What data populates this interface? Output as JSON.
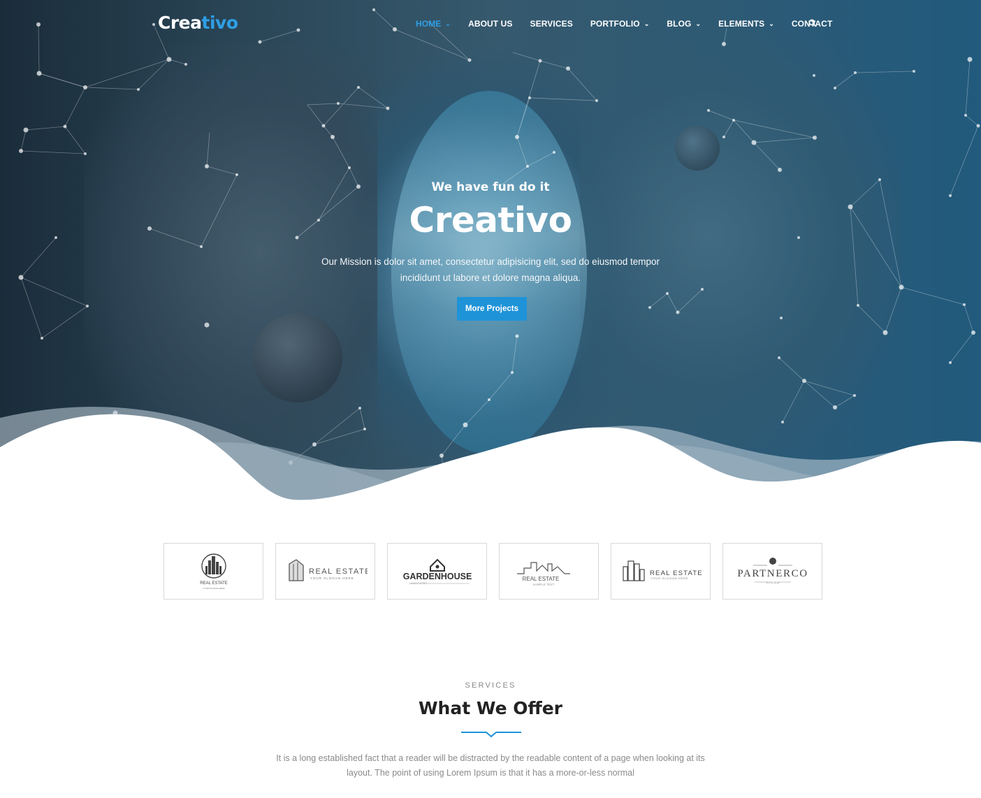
{
  "brand": {
    "logo_part1": "Crea",
    "logo_part2": "tivo",
    "accent_color": "#2f9fe6"
  },
  "nav": {
    "items": [
      {
        "label": "HOME",
        "active": true,
        "dropdown": true
      },
      {
        "label": "ABOUT US",
        "active": false,
        "dropdown": false
      },
      {
        "label": "SERVICES",
        "active": false,
        "dropdown": false
      },
      {
        "label": "PORTFOLIO",
        "active": false,
        "dropdown": true
      },
      {
        "label": "BLOG",
        "active": false,
        "dropdown": true
      },
      {
        "label": "ELEMENTS",
        "active": false,
        "dropdown": true
      },
      {
        "label": "CONTACT",
        "active": false,
        "dropdown": false
      }
    ],
    "search_icon": "search-icon"
  },
  "hero": {
    "tagline": "We have fun do it",
    "title": "Creativo",
    "description": "Our Mission is dolor sit amet, consectetur adipisicing elit, sed do eiusmod tempor incididunt ut labore et dolore magna aliqua.",
    "button_label": "More Projects",
    "button_color": "#1f93d8"
  },
  "partners": [
    {
      "name": "REAL ESTATE",
      "sub": "YOUR SLOGAN HERE"
    },
    {
      "name": "REAL ESTATE",
      "sub": "YOUR SLOGAN HERE"
    },
    {
      "name": "GARDENHOUSE",
      "sub": "LANDSCAPING"
    },
    {
      "name": "REAL ESTATE",
      "sub": "SAMPLE TEXT"
    },
    {
      "name": "REAL ESTATE",
      "sub": "YOUR SLOGAN HERE"
    },
    {
      "name": "PARTNERCO",
      "sub": "ESTD 2016"
    }
  ],
  "services": {
    "label": "SERVICES",
    "title": "What We Offer",
    "text": "It is a long established fact that a reader will be distracted by the readable content of a page when looking at its layout. The point of using Lorem Ipsum is that it has a more-or-less normal"
  }
}
